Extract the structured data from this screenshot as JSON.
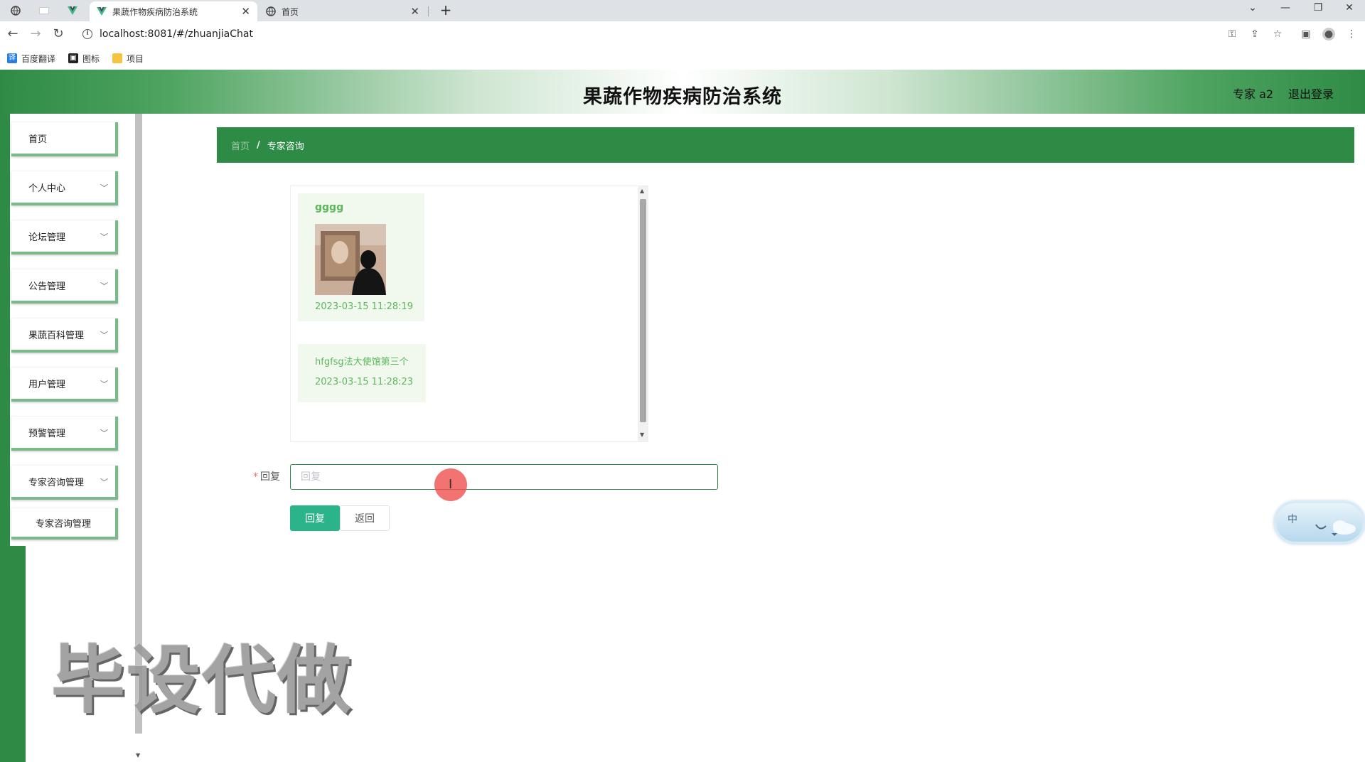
{
  "browser": {
    "tabs": [
      {
        "title": "果蔬作物疾病防治系统",
        "active": true
      },
      {
        "title": "首页",
        "active": false
      }
    ],
    "url": "localhost:8081/#/zhuanjiaChat",
    "bookmarks": [
      "百度翻译",
      "图标",
      "项目"
    ]
  },
  "header": {
    "title": "果蔬作物疾病防治系统",
    "user": "专家 a2",
    "logout": "退出登录"
  },
  "sidebar": {
    "items": [
      {
        "label": "首页",
        "has_children": false
      },
      {
        "label": "个人中心",
        "has_children": true
      },
      {
        "label": "论坛管理",
        "has_children": true
      },
      {
        "label": "公告管理",
        "has_children": true
      },
      {
        "label": "果蔬百科管理",
        "has_children": true
      },
      {
        "label": "用户管理",
        "has_children": true
      },
      {
        "label": "预警管理",
        "has_children": true
      },
      {
        "label": "专家咨询管理",
        "has_children": true
      }
    ],
    "submenu": [
      "专家咨询管理"
    ]
  },
  "breadcrumb": {
    "home": "首页",
    "separator": "/",
    "current": "专家咨询"
  },
  "chat": {
    "messages": [
      {
        "name": "gggg",
        "has_image": true,
        "time": "2023-03-15 11:28:19"
      },
      {
        "text": "hfgfsg法大使馆第三个",
        "time": "2023-03-15 11:28:23"
      }
    ]
  },
  "form": {
    "label": "回复",
    "required_mark": "*",
    "placeholder": "回复",
    "value": "",
    "submit": "回复",
    "back": "返回"
  },
  "widget": {
    "label": "中"
  },
  "watermark": "毕设代做",
  "colors": {
    "primary_green": "#2e8b45",
    "button_teal": "#2bb38a",
    "message_text": "#5cb85c",
    "message_bg": "#f1f8ee"
  }
}
